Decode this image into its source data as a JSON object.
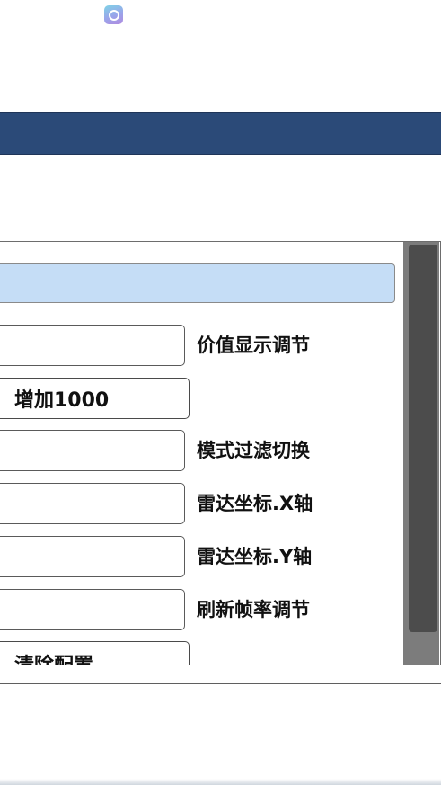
{
  "settings": {
    "items": [
      {
        "type": "field",
        "label": "价值显示调节"
      },
      {
        "type": "button",
        "text": "增加1000"
      },
      {
        "type": "field",
        "label": "模式过滤切换"
      },
      {
        "type": "field",
        "label": "雷达坐标.X轴"
      },
      {
        "type": "field",
        "label": "雷达坐标.Y轴"
      },
      {
        "type": "field",
        "label": "刷新帧率调节"
      },
      {
        "type": "button",
        "text": "清除配置"
      }
    ]
  },
  "icons": {
    "app_icon": "app-icon"
  },
  "colors": {
    "title_bar": "#2b4a78",
    "highlight": "#c5ddf6",
    "scrollbar_thumb": "#4c4c4c"
  }
}
